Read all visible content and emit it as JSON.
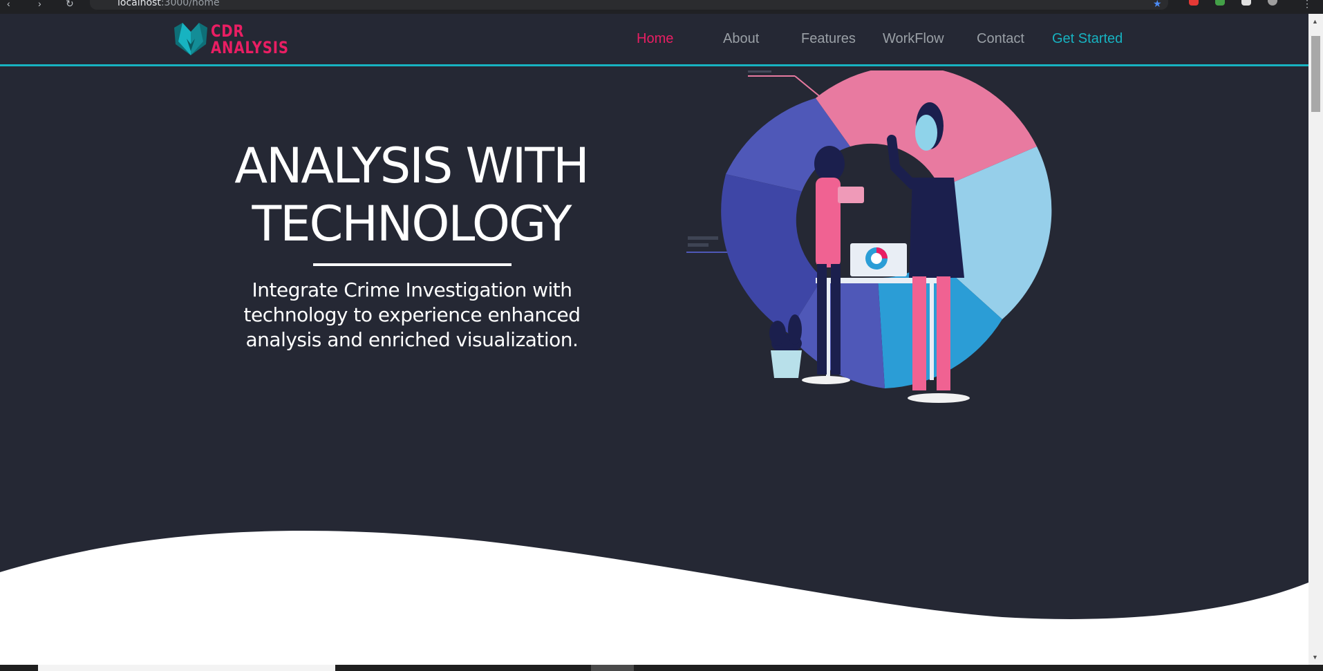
{
  "browser": {
    "url_host": "localhost",
    "url_rest": ":3000/home"
  },
  "brand": {
    "line1": "CDR",
    "line2": "ANALYSIS",
    "accent": "#e91e63",
    "teal": "#17b3c1"
  },
  "nav": {
    "items": [
      {
        "label": "Home",
        "active": true
      },
      {
        "label": "About"
      },
      {
        "label": "Features"
      },
      {
        "label": "WorkFlow"
      },
      {
        "label": "Contact"
      },
      {
        "label": "Get Started",
        "highlight": true
      }
    ],
    "active_color": "#e91e63",
    "default_color": "#9aa0a6",
    "highlight_color": "#17b3c1"
  },
  "hero": {
    "title_line1": "ANALYSIS WITH",
    "title_line2": "TECHNOLOGY",
    "subtitle_line1": "Integrate Crime Investigation with",
    "subtitle_line2": "technology to experience enhanced",
    "subtitle_line3": "analysis and enriched visualization."
  },
  "colors": {
    "page_bg": "#252834",
    "wave_bg": "#ffffff"
  }
}
